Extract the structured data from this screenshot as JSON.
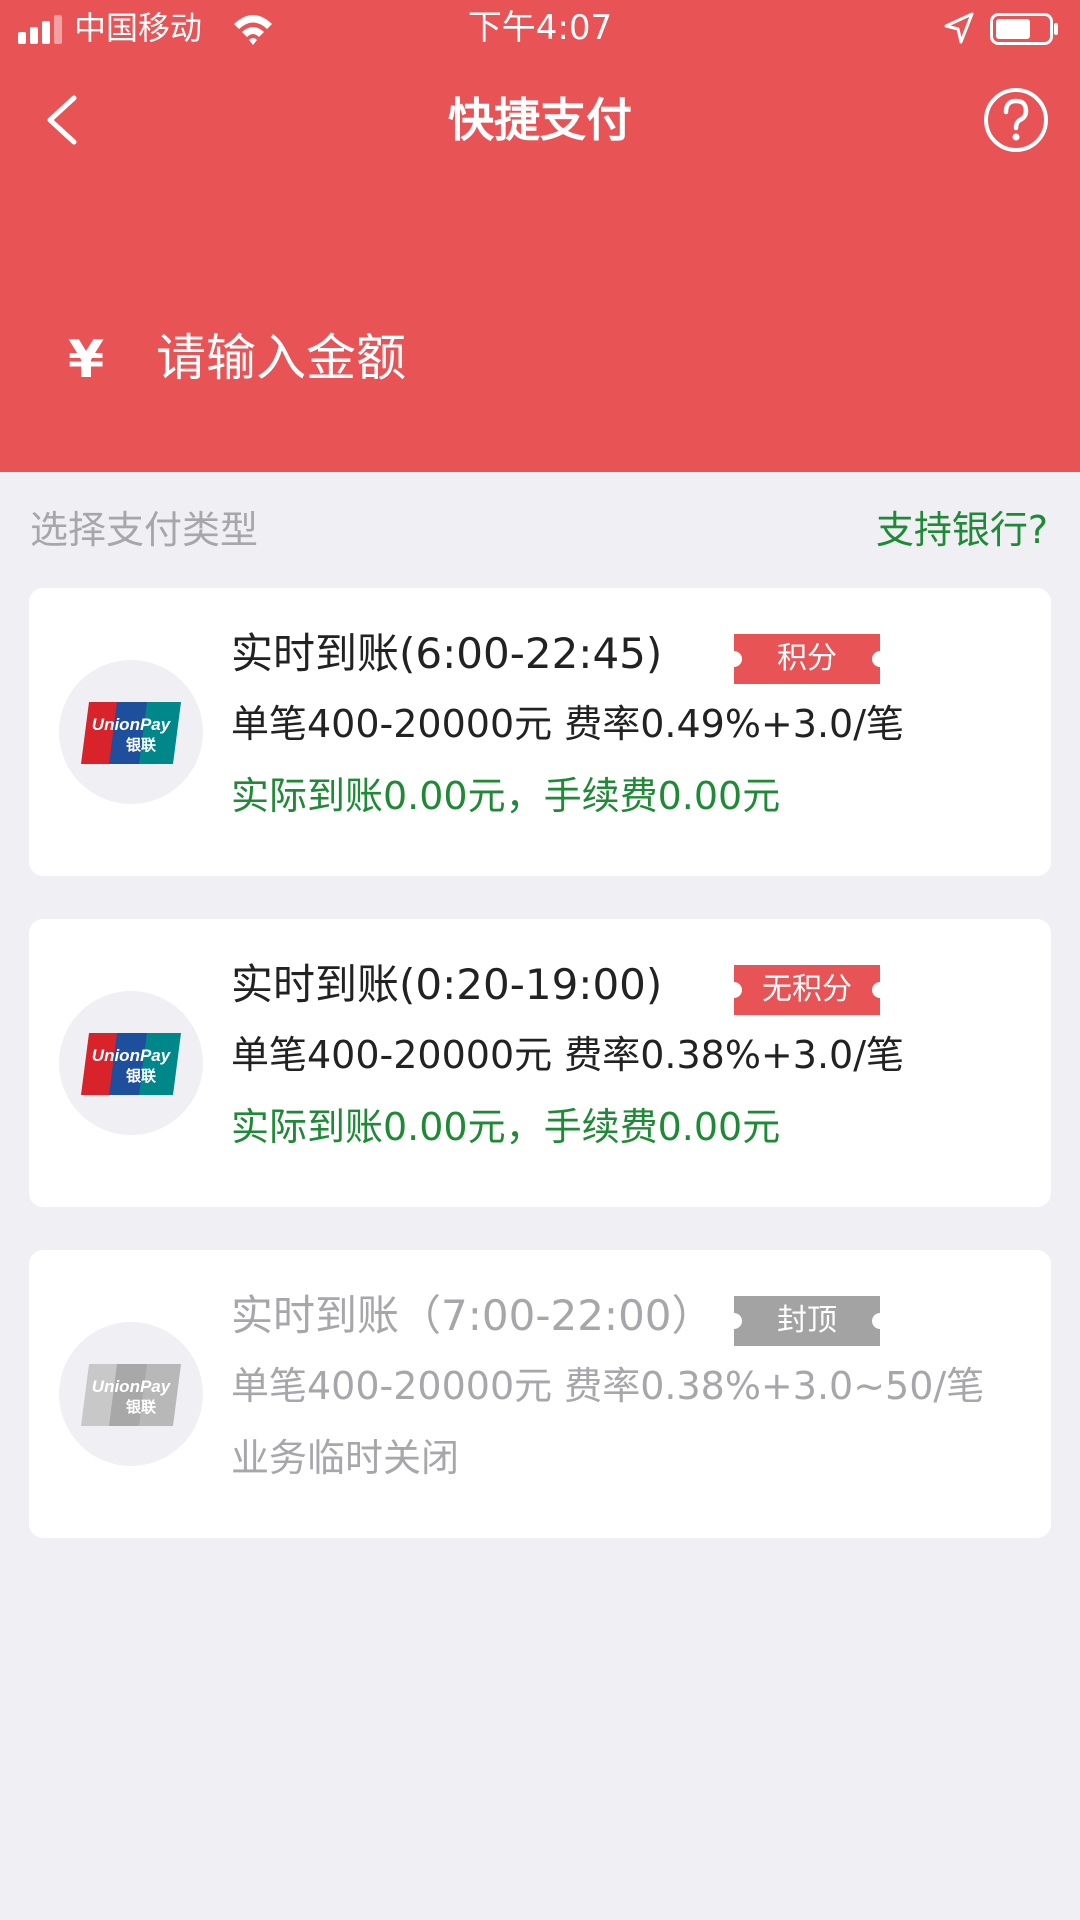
{
  "status": {
    "carrier": "中国移动",
    "time": "下午4:07"
  },
  "header": {
    "title": "快捷支付"
  },
  "amount": {
    "currency": "¥",
    "placeholder": "请输入金额"
  },
  "section": {
    "label": "选择支付类型",
    "bank_link": "支持银行?"
  },
  "channels": [
    {
      "title": "实时到账(6:00-22:45)",
      "tag": "积分",
      "tag_color": "#e85355",
      "rate": "单笔400-20000元 费率0.49%+3.0/笔",
      "note": "实际到账0.00元，手续费0.00元",
      "enabled": true
    },
    {
      "title": "实时到账(0:20-19:00)",
      "tag": "无积分",
      "tag_color": "#e85355",
      "rate": "单笔400-20000元 费率0.38%+3.0/笔",
      "note": "实际到账0.00元，手续费0.00元",
      "enabled": true
    },
    {
      "title": "实时到账（7:00-22:00）",
      "tag": "封顶",
      "tag_color": "#a3a3a3",
      "rate": "单笔400-20000元 费率0.38%+3.0~50/笔",
      "note": "业务临时关闭",
      "enabled": false
    }
  ],
  "icons": [
    "signal-icon",
    "wifi-icon",
    "location-arrow-icon",
    "battery-icon",
    "back-chevron-icon",
    "help-icon",
    "unionpay-logo-icon"
  ],
  "colors": {
    "header_red": "#e85355",
    "green_text": "#1f8a35",
    "gray_text": "#a6a6ab",
    "background": "#efeff4"
  }
}
